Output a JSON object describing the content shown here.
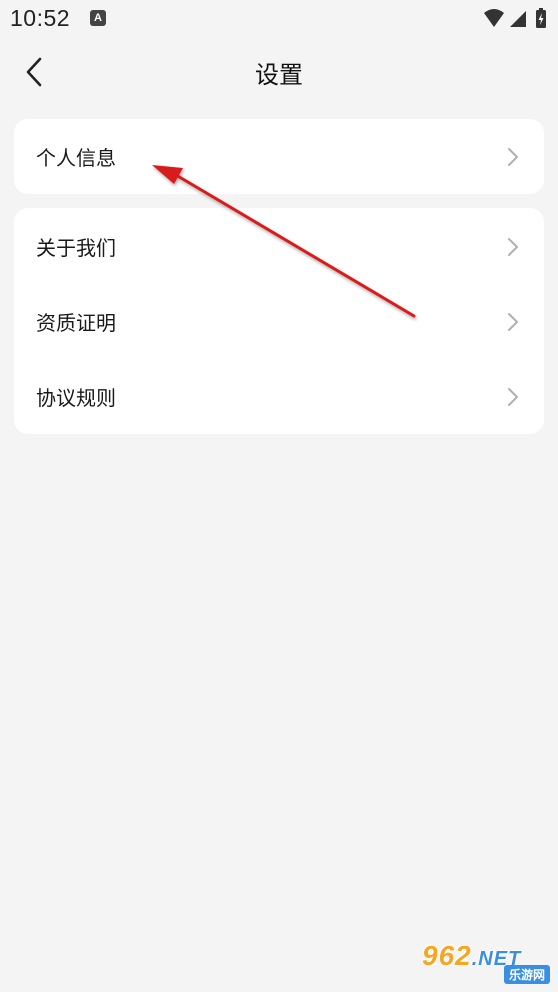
{
  "status": {
    "time": "10:52",
    "notification_icon": "a-icon",
    "icons": [
      "wifi-icon",
      "signal-icon",
      "battery-icon"
    ]
  },
  "header": {
    "title": "设置",
    "back_icon": "chevron-left-icon"
  },
  "groups": [
    {
      "items": [
        {
          "label": "个人信息"
        }
      ]
    },
    {
      "items": [
        {
          "label": "关于我们"
        },
        {
          "label": "资质证明"
        },
        {
          "label": "协议规则"
        }
      ]
    }
  ],
  "annotation": {
    "arrow_color": "#d81e1e"
  },
  "watermark": {
    "brand": "962",
    "tld": ".NET",
    "subtitle": "乐游网"
  },
  "colors": {
    "background": "#f4f4f4",
    "card": "#ffffff",
    "chevron": "#b0b0b0"
  }
}
